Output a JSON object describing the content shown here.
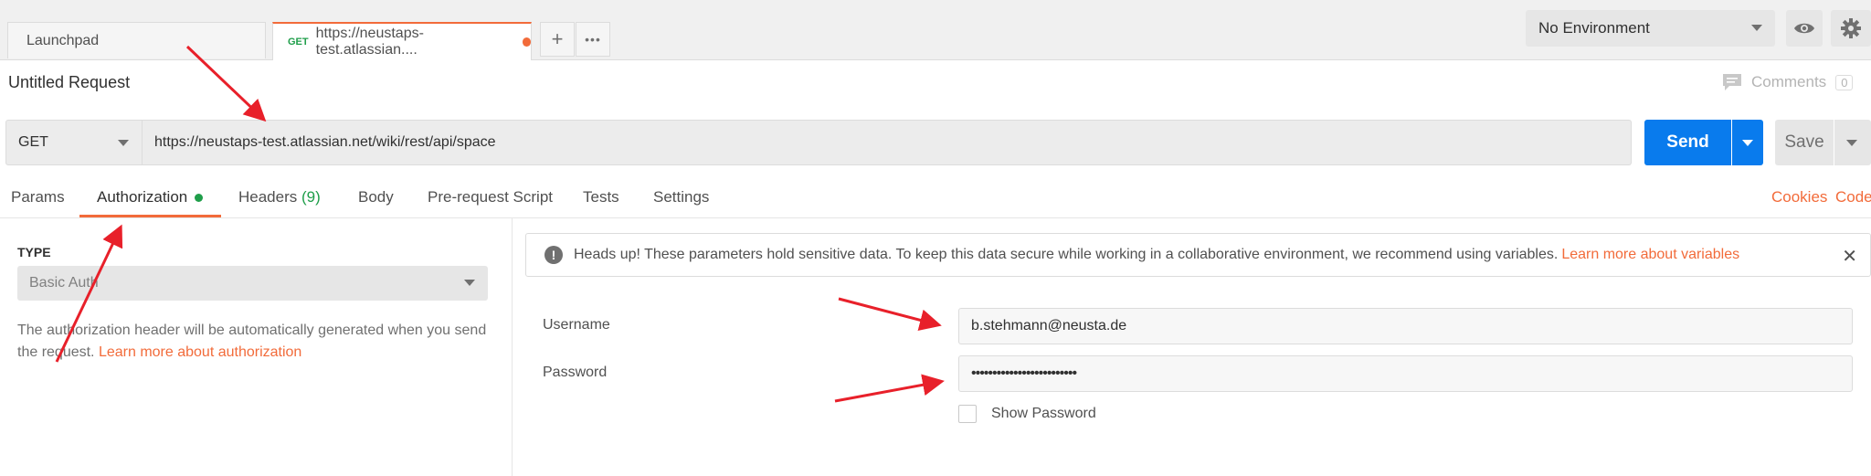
{
  "tabs": {
    "launchpad": "Launchpad",
    "request_method": "GET",
    "request_title": "https://neustaps-test.atlassian....",
    "new_tab": "+",
    "more": "•••"
  },
  "environment": {
    "selected": "No Environment"
  },
  "request": {
    "title": "Untitled Request",
    "comments_label": "Comments",
    "comments_count": "0",
    "method": "GET",
    "url": "https://neustaps-test.atlassian.net/wiki/rest/api/space",
    "send_label": "Send",
    "save_label": "Save"
  },
  "subtabs": {
    "params": "Params",
    "authorization": "Authorization",
    "headers": "Headers",
    "headers_count": "(9)",
    "body": "Body",
    "prerequest": "Pre-request Script",
    "tests": "Tests",
    "settings": "Settings",
    "cookies": "Cookies",
    "code": "Code"
  },
  "auth": {
    "type_label": "TYPE",
    "type_value": "Basic Auth",
    "description": "The authorization header will be automatically generated when you send the request.",
    "learn_more": "Learn more about authorization",
    "warning_text": "Heads up! These parameters hold sensitive data. To keep this data secure while working in a collaborative environment, we recommend using variables.",
    "warning_link": "Learn more about variables",
    "username_label": "Username",
    "username_value": "b.stehmann@neusta.de",
    "password_label": "Password",
    "password_value": "•••••••••••••••••••••••••",
    "show_password_label": "Show Password"
  },
  "colors": {
    "accent": "#f26b3a",
    "send_button": "#097bed",
    "method_green": "#1f9e4a",
    "annotation_arrow": "#e8202a"
  }
}
